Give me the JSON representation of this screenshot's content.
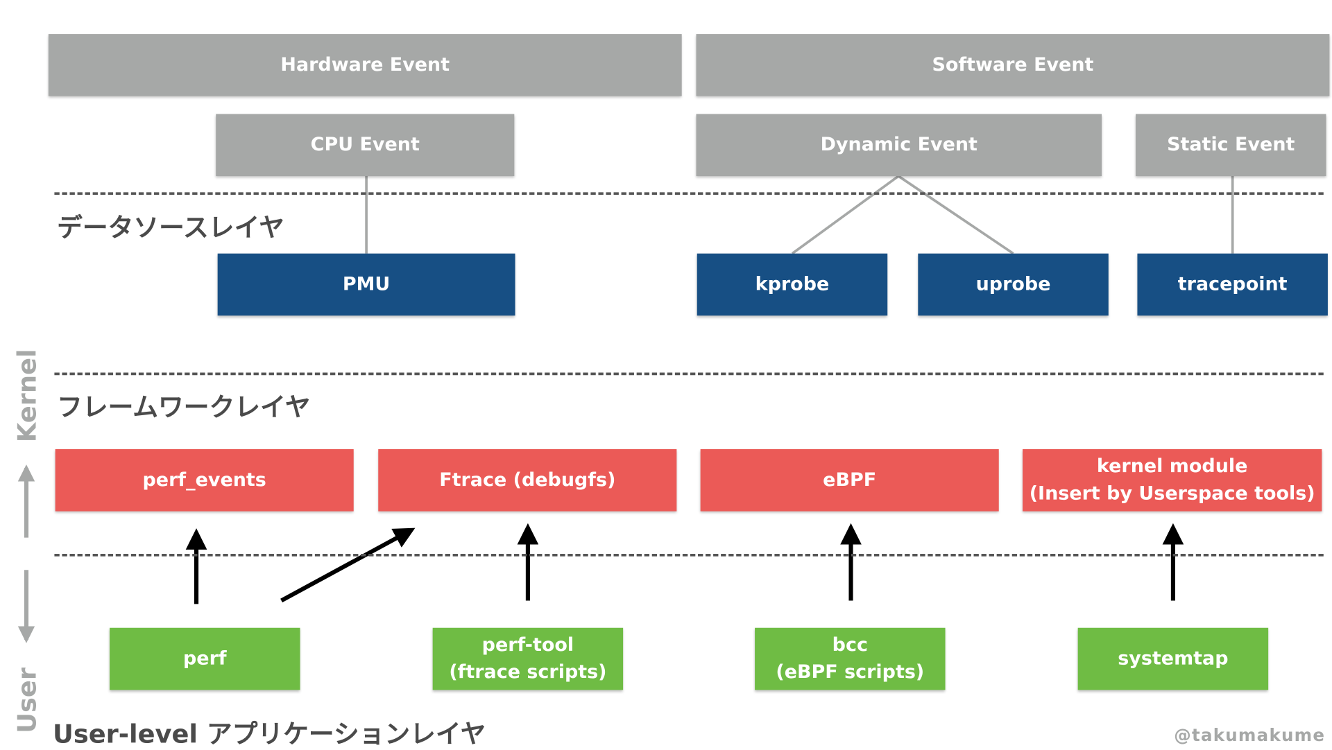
{
  "events": {
    "hardware": "Hardware Event",
    "software": "Software Event",
    "cpu": "CPU Event",
    "dynamic": "Dynamic Event",
    "static": "Static Event"
  },
  "sources": {
    "pmu": "PMU",
    "kprobe": "kprobe",
    "uprobe": "uprobe",
    "tracepoint": "tracepoint"
  },
  "frameworks": {
    "perf_events": "perf_events",
    "ftrace": "Ftrace (debugfs)",
    "ebpf": "eBPF",
    "kernel_module": "kernel module\n(Insert by Userspace tools)"
  },
  "tools": {
    "perf": "perf",
    "perf_tool": "perf-tool\n(ftrace scripts)",
    "bcc": "bcc\n(eBPF scripts)",
    "systemtap": "systemtap"
  },
  "layers": {
    "data_source": "データソースレイヤ",
    "framework": "フレームワークレイヤ",
    "user_level": "User-level アプリケーションレイヤ"
  },
  "side": {
    "kernel": "Kernel",
    "user": "User"
  },
  "credit": "@takumakume",
  "colors": {
    "event_gray": "#a6a8a7",
    "source_blue": "#174f84",
    "framework_red": "#eb5a57",
    "tool_green": "#6fbc44"
  }
}
